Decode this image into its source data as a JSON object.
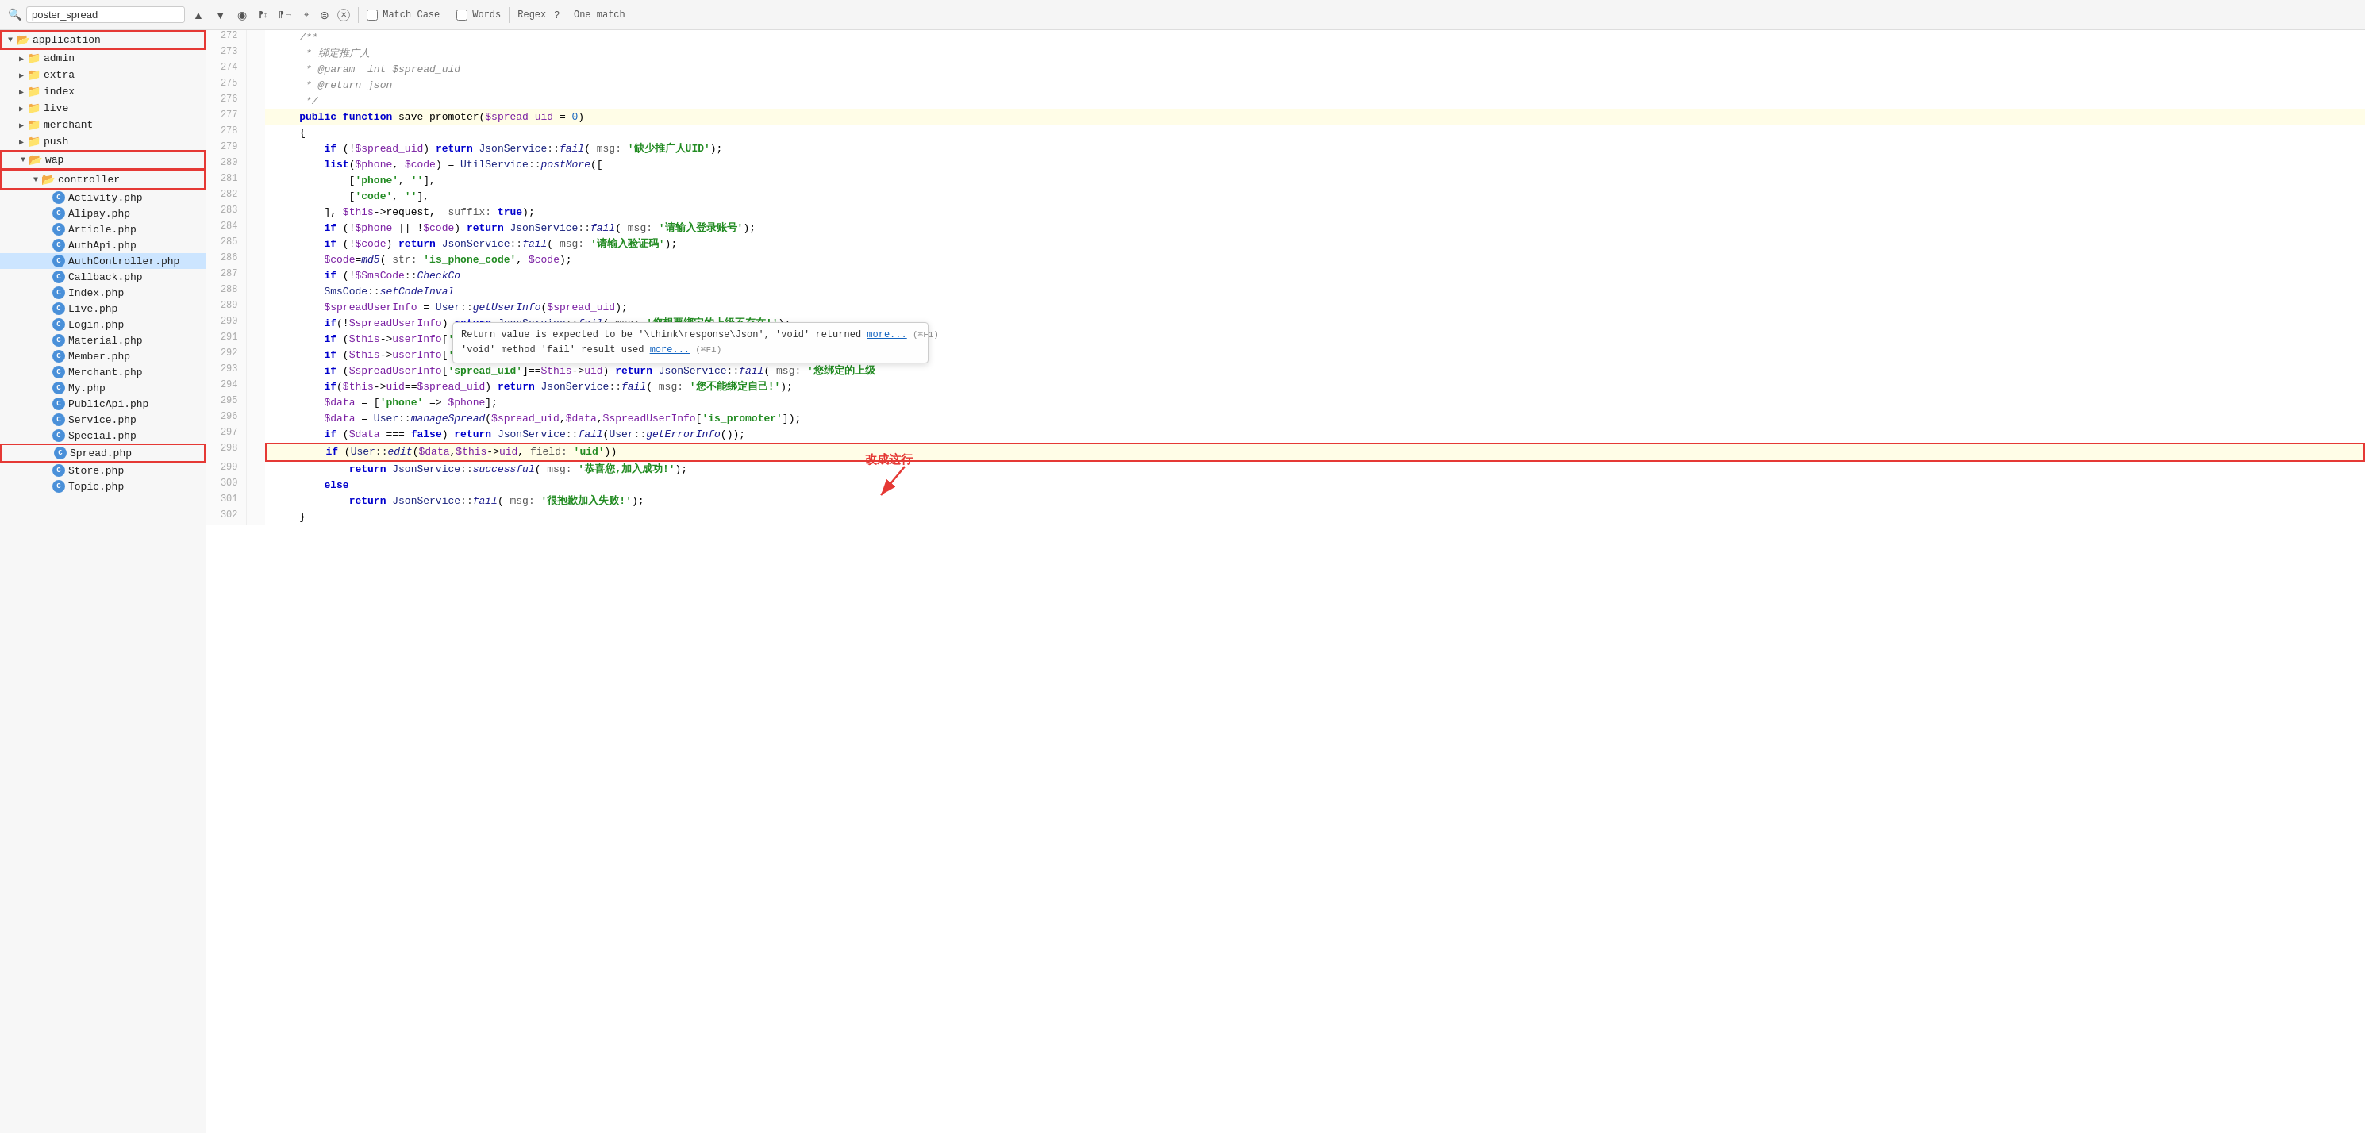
{
  "searchBar": {
    "searchValue": "poster_spread",
    "placeholder": "poster_spread",
    "matchCase": false,
    "words": false,
    "regex": false,
    "matchResult": "One match",
    "matchCaseLabel": "Match Case",
    "wordsLabel": "Words",
    "regexLabel": "Regex"
  },
  "sidebar": {
    "items": [
      {
        "id": "application",
        "label": "application",
        "type": "folder",
        "indent": 0,
        "expanded": true,
        "outlined": true
      },
      {
        "id": "admin",
        "label": "admin",
        "type": "folder",
        "indent": 1,
        "expanded": false
      },
      {
        "id": "extra",
        "label": "extra",
        "type": "folder",
        "indent": 1,
        "expanded": false
      },
      {
        "id": "index",
        "label": "index",
        "type": "folder",
        "indent": 1,
        "expanded": false
      },
      {
        "id": "live",
        "label": "live",
        "type": "folder",
        "indent": 1,
        "expanded": false
      },
      {
        "id": "merchant",
        "label": "merchant",
        "type": "folder",
        "indent": 1,
        "expanded": false
      },
      {
        "id": "push",
        "label": "push",
        "type": "folder",
        "indent": 1,
        "expanded": false
      },
      {
        "id": "wap",
        "label": "wap",
        "type": "folder",
        "indent": 1,
        "expanded": true,
        "outlined": true
      },
      {
        "id": "controller",
        "label": "controller",
        "type": "folder",
        "indent": 2,
        "expanded": true,
        "outlined": true
      },
      {
        "id": "Activity.php",
        "label": "Activity.php",
        "type": "file",
        "indent": 3
      },
      {
        "id": "Alipay.php",
        "label": "Alipay.php",
        "type": "file",
        "indent": 3
      },
      {
        "id": "Article.php",
        "label": "Article.php",
        "type": "file",
        "indent": 3
      },
      {
        "id": "AuthApi.php",
        "label": "AuthApi.php",
        "type": "file",
        "indent": 3
      },
      {
        "id": "AuthController.php",
        "label": "AuthController.php",
        "type": "file",
        "indent": 3,
        "selected": true
      },
      {
        "id": "Callback.php",
        "label": "Callback.php",
        "type": "file",
        "indent": 3
      },
      {
        "id": "Index.php",
        "label": "Index.php",
        "type": "file",
        "indent": 3
      },
      {
        "id": "Live.php",
        "label": "Live.php",
        "type": "file",
        "indent": 3
      },
      {
        "id": "Login.php",
        "label": "Login.php",
        "type": "file",
        "indent": 3
      },
      {
        "id": "Material.php",
        "label": "Material.php",
        "type": "file",
        "indent": 3
      },
      {
        "id": "Member.php",
        "label": "Member.php",
        "type": "file",
        "indent": 3
      },
      {
        "id": "Merchant.php",
        "label": "Merchant.php",
        "type": "file",
        "indent": 3
      },
      {
        "id": "My.php",
        "label": "My.php",
        "type": "file",
        "indent": 3
      },
      {
        "id": "PublicApi.php",
        "label": "PublicApi.php",
        "type": "file",
        "indent": 3
      },
      {
        "id": "Service.php",
        "label": "Service.php",
        "type": "file",
        "indent": 3
      },
      {
        "id": "Special.php",
        "label": "Special.php",
        "type": "file",
        "indent": 3
      },
      {
        "id": "Spread.php",
        "label": "Spread.php",
        "type": "file",
        "indent": 3,
        "outlined": true
      },
      {
        "id": "Store.php",
        "label": "Store.php",
        "type": "file",
        "indent": 3
      },
      {
        "id": "Topic.php",
        "label": "Topic.php",
        "type": "file",
        "indent": 3
      }
    ]
  },
  "tooltip": {
    "line1": "Return value is expected to be '\\think\\response\\Json', 'void' returned",
    "line1link": "more...",
    "line1shortcut": "(⌘F1)",
    "line2": "'void' method 'fail' result used",
    "line2link": "more...",
    "line2shortcut": "(⌘F1)"
  },
  "redAnnotation": {
    "text": "改成这行"
  },
  "lines": [
    {
      "num": 272,
      "content": "    /**"
    },
    {
      "num": 273,
      "content": "     * 绑定推广人"
    },
    {
      "num": 274,
      "content": "     * @param  int $spread_uid"
    },
    {
      "num": 275,
      "content": "     * @return json"
    },
    {
      "num": 276,
      "content": "     */"
    },
    {
      "num": 277,
      "content": "    public function save_promoter($spread_uid = 0)",
      "highlighted": true
    },
    {
      "num": 278,
      "content": "    {"
    },
    {
      "num": 279,
      "content": "        if (!$spread_uid) return JsonService::fail( msg: '缺少推广人UID');"
    },
    {
      "num": 280,
      "content": "        list($phone, $code) = UtilService::postMore(["
    },
    {
      "num": 281,
      "content": "            ['phone', ''],"
    },
    {
      "num": 282,
      "content": "            ['code', ''],"
    },
    {
      "num": 283,
      "content": "        ], $this->request,  suffix: true);"
    },
    {
      "num": 284,
      "content": "        if (!$phone || !$code) return JsonService::fail( msg: '请输入登录账号');"
    },
    {
      "num": 285,
      "content": "        if (!$code) return JsonService::fail( msg: '请输入验证码');"
    },
    {
      "num": 286,
      "content": "        $code=md5( str: 'is_phone_code', $code);"
    },
    {
      "num": 287,
      "content": "        if (!$SmsCode::CheckCo",
      "tooltip": true
    },
    {
      "num": 288,
      "content": "        SmsCode::setCodeInval"
    },
    {
      "num": 289,
      "content": "        $spreadUserInfo = User::getUserInfo($spread_uid);"
    },
    {
      "num": 290,
      "content": "        if(!$spreadUserInfo) return JsonService::fail( msg: '您想要绑定的上级不存在!');"
    },
    {
      "num": 291,
      "content": "        if ($this->userInfo['spread_uid']==$spread_uid) return JsonService::fail( msg: $spreadUs"
    },
    {
      "num": 292,
      "content": "        if ($this->userInfo['is_promoter']) return JsonService::fail( msg: '您已经成为推广人,无法绑定"
    },
    {
      "num": 293,
      "content": "        if ($spreadUserInfo['spread_uid']==$this->uid) return JsonService::fail( msg: '您绑定的上级"
    },
    {
      "num": 294,
      "content": "        if($this->uid==$spread_uid) return JsonService::fail( msg: '您不能绑定自己!');"
    },
    {
      "num": 295,
      "content": "        $data = ['phone' => $phone];"
    },
    {
      "num": 296,
      "content": "        $data = User::manageSpread($spread_uid,$data,$spreadUserInfo['is_promoter']);"
    },
    {
      "num": 297,
      "content": "        if ($data === false) return JsonService::fail(User::getErrorInfo());"
    },
    {
      "num": 298,
      "content": "        if (User::edit($data,$this->uid, field: 'uid'))",
      "search_highlighted": true,
      "outlined": true
    },
    {
      "num": 299,
      "content": "            return JsonService::successful( msg: '恭喜您,加入成功!');"
    },
    {
      "num": 300,
      "content": "        else"
    },
    {
      "num": 301,
      "content": "            return JsonService::fail( msg: '很抱歉加入失败!');"
    },
    {
      "num": 302,
      "content": "    }"
    }
  ]
}
